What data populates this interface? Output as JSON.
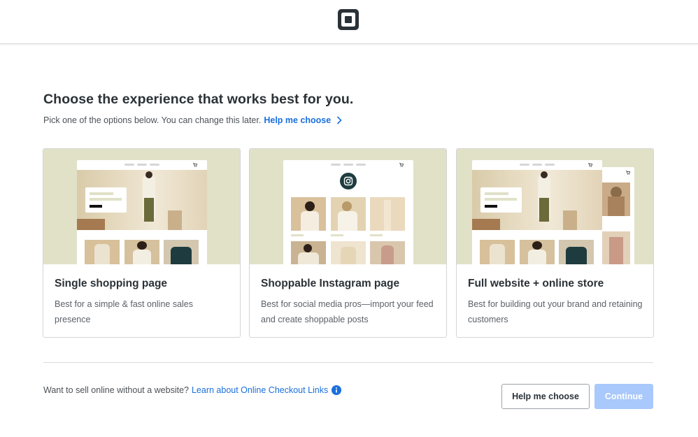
{
  "header": {
    "logo_icon": "square-logo-icon"
  },
  "main": {
    "heading": "Choose the experience that works best for you.",
    "subtitle": "Pick one of the options below. You can change this later.",
    "help_link": "Help me choose"
  },
  "cards": [
    {
      "title": "Single shopping page",
      "description": "Best for a simple & fast online sales presence"
    },
    {
      "title": "Shoppable Instagram page",
      "description": "Best for social media pros—import your feed and create shoppable posts"
    },
    {
      "title": "Full website + online store",
      "description": "Best for building out your brand and retaining customers"
    }
  ],
  "footer": {
    "note": "Want to sell online without a website?",
    "link": "Learn about Online Checkout Links",
    "help_button": "Help me choose",
    "continue_button": "Continue"
  },
  "colors": {
    "accent": "#1a6fdc",
    "primary_disabled": "#a9c8fb",
    "thumb_bg": "#e1e1c8"
  }
}
